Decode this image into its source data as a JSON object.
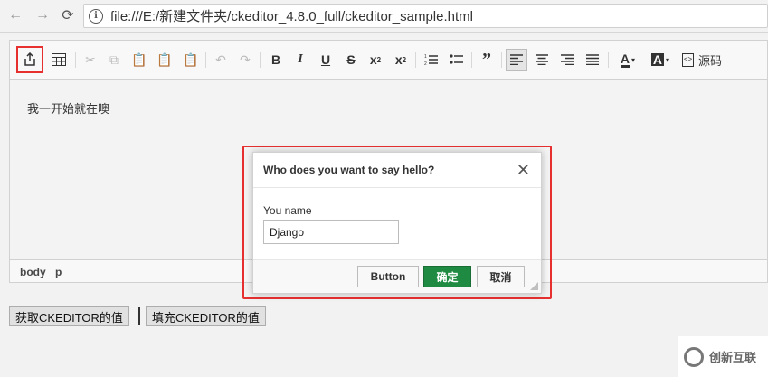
{
  "browser": {
    "url": "file:///E:/新建文件夹/ckeditor_4.8.0_full/ckeditor_sample.html",
    "back_icon": "←",
    "forward_icon": "→",
    "reload_icon": "⟳",
    "info_icon": "i"
  },
  "toolbar": {
    "source_label": "源码"
  },
  "editor": {
    "content_text": "我一开始就在噢",
    "path": [
      "body",
      "p"
    ]
  },
  "page_buttons": {
    "get": "获取CKEDITOR的值",
    "fill": "填充CKEDITOR的值"
  },
  "dialog": {
    "title": "Who does you want to say hello?",
    "close": "✕",
    "field_label": "You name",
    "field_value": "Django",
    "buttons": {
      "button": "Button",
      "ok": "确定",
      "cancel": "取消"
    }
  },
  "watermark": {
    "text": "创新互联"
  },
  "colors": {
    "highlight_border": "#e63030",
    "ok_button": "#1e8a42"
  }
}
